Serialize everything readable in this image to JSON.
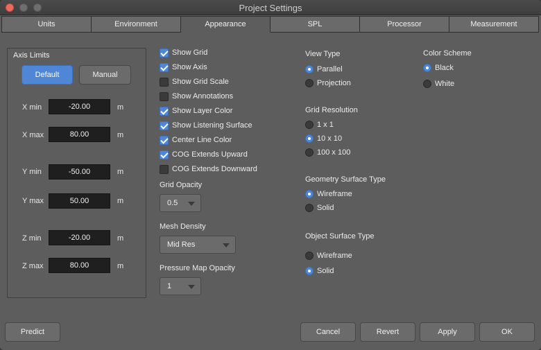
{
  "window": {
    "title": "Project Settings"
  },
  "tabs": [
    "Units",
    "Environment",
    "Appearance",
    "SPL",
    "Processor",
    "Measurement"
  ],
  "axis_limits": {
    "title": "Axis Limits",
    "default_label": "Default",
    "manual_label": "Manual",
    "unit": "m",
    "rows": [
      {
        "label": "X min",
        "value": "-20.00"
      },
      {
        "label": "X max",
        "value": "80.00"
      },
      {
        "label": "Y min",
        "value": "-50.00"
      },
      {
        "label": "Y max",
        "value": "50.00"
      },
      {
        "label": "Z min",
        "value": "-20.00"
      },
      {
        "label": "Z max",
        "value": "80.00"
      }
    ]
  },
  "checkboxes": [
    {
      "label": "Show Grid",
      "checked": true
    },
    {
      "label": "Show Axis",
      "checked": true
    },
    {
      "label": "Show Grid Scale",
      "checked": false
    },
    {
      "label": "Show Annotations",
      "checked": false
    },
    {
      "label": "Show Layer Color",
      "checked": true
    },
    {
      "label": "Show Listening Surface",
      "checked": true
    },
    {
      "label": "Center Line Color",
      "checked": true
    },
    {
      "label": "COG Extends Upward",
      "checked": true
    },
    {
      "label": "COG Extends Downward",
      "checked": false
    }
  ],
  "grid_opacity": {
    "label": "Grid Opacity",
    "value": "0.5"
  },
  "mesh_density": {
    "label": "Mesh Density",
    "value": "Mid Res"
  },
  "pressure_map_opacity": {
    "label": "Pressure Map Opacity",
    "value": "1"
  },
  "view_type": {
    "label": "View Type",
    "options": [
      "Parallel",
      "Projection"
    ],
    "selected": 0
  },
  "grid_resolution": {
    "label": "Grid Resolution",
    "options": [
      "1 x 1",
      "10 x 10",
      "100 x 100"
    ],
    "selected": 1
  },
  "geometry_surface_type": {
    "label": "Geometry Surface Type",
    "options": [
      "Wireframe",
      "Solid"
    ],
    "selected": 0
  },
  "object_surface_type": {
    "label": "Object Surface Type",
    "options": [
      "Wireframe",
      "Solid"
    ],
    "selected": 1
  },
  "color_scheme": {
    "label": "Color Scheme",
    "options": [
      "Black",
      "White"
    ],
    "selected": 0
  },
  "footer": {
    "predict_label": "Predict",
    "cancel_label": "Cancel",
    "revert_label": "Revert",
    "apply_label": "Apply",
    "ok_label": "OK"
  },
  "colors": {
    "accent": "#4f87d6",
    "background": "#5d5d5d",
    "close_button": "#ed6a5e"
  }
}
